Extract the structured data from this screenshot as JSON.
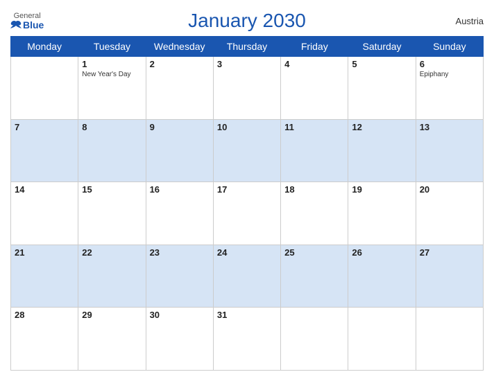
{
  "header": {
    "title": "January 2030",
    "country": "Austria",
    "logo": {
      "general": "General",
      "blue": "Blue"
    }
  },
  "days_of_week": [
    "Monday",
    "Tuesday",
    "Wednesday",
    "Thursday",
    "Friday",
    "Saturday",
    "Sunday"
  ],
  "weeks": [
    [
      {
        "day": "",
        "holiday": ""
      },
      {
        "day": "1",
        "holiday": "New Year's Day"
      },
      {
        "day": "2",
        "holiday": ""
      },
      {
        "day": "3",
        "holiday": ""
      },
      {
        "day": "4",
        "holiday": ""
      },
      {
        "day": "5",
        "holiday": ""
      },
      {
        "day": "6",
        "holiday": "Epiphany"
      }
    ],
    [
      {
        "day": "7",
        "holiday": ""
      },
      {
        "day": "8",
        "holiday": ""
      },
      {
        "day": "9",
        "holiday": ""
      },
      {
        "day": "10",
        "holiday": ""
      },
      {
        "day": "11",
        "holiday": ""
      },
      {
        "day": "12",
        "holiday": ""
      },
      {
        "day": "13",
        "holiday": ""
      }
    ],
    [
      {
        "day": "14",
        "holiday": ""
      },
      {
        "day": "15",
        "holiday": ""
      },
      {
        "day": "16",
        "holiday": ""
      },
      {
        "day": "17",
        "holiday": ""
      },
      {
        "day": "18",
        "holiday": ""
      },
      {
        "day": "19",
        "holiday": ""
      },
      {
        "day": "20",
        "holiday": ""
      }
    ],
    [
      {
        "day": "21",
        "holiday": ""
      },
      {
        "day": "22",
        "holiday": ""
      },
      {
        "day": "23",
        "holiday": ""
      },
      {
        "day": "24",
        "holiday": ""
      },
      {
        "day": "25",
        "holiday": ""
      },
      {
        "day": "26",
        "holiday": ""
      },
      {
        "day": "27",
        "holiday": ""
      }
    ],
    [
      {
        "day": "28",
        "holiday": ""
      },
      {
        "day": "29",
        "holiday": ""
      },
      {
        "day": "30",
        "holiday": ""
      },
      {
        "day": "31",
        "holiday": ""
      },
      {
        "day": "",
        "holiday": ""
      },
      {
        "day": "",
        "holiday": ""
      },
      {
        "day": "",
        "holiday": ""
      }
    ]
  ]
}
